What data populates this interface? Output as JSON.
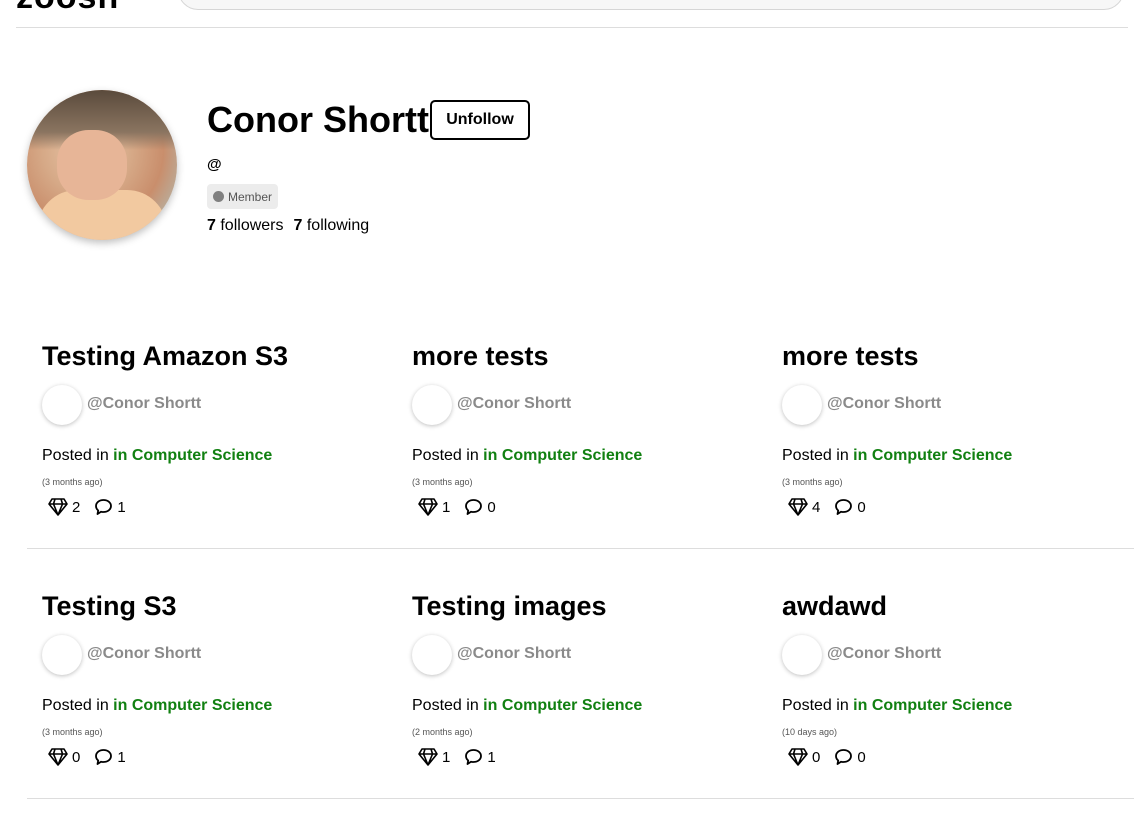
{
  "header": {
    "logo_text": "zoosh",
    "search_placeholder": ""
  },
  "profile": {
    "name": "Conor Shortt",
    "follow_button_label": "Unfollow",
    "handle": "@",
    "role_badge": "Member",
    "followers_count": "7",
    "followers_label": "followers",
    "following_count": "7",
    "following_label": "following"
  },
  "posts": [
    {
      "title": "Testing Amazon S3",
      "author": "@Conor Shortt",
      "posted_prefix": "Posted in",
      "category": "in Computer Science",
      "time": "(3 months ago)",
      "gems": "2",
      "comments": "1"
    },
    {
      "title": "more tests",
      "author": "@Conor Shortt",
      "posted_prefix": "Posted in",
      "category": "in Computer Science",
      "time": "(3 months ago)",
      "gems": "1",
      "comments": "0"
    },
    {
      "title": "more tests",
      "author": "@Conor Shortt",
      "posted_prefix": "Posted in",
      "category": "in Computer Science",
      "time": "(3 months ago)",
      "gems": "4",
      "comments": "0"
    },
    {
      "title": "Testing S3",
      "author": "@Conor Shortt",
      "posted_prefix": "Posted in",
      "category": "in Computer Science",
      "time": "(3 months ago)",
      "gems": "0",
      "comments": "1"
    },
    {
      "title": "Testing images",
      "author": "@Conor Shortt",
      "posted_prefix": "Posted in",
      "category": "in Computer Science",
      "time": "(2 months ago)",
      "gems": "1",
      "comments": "1"
    },
    {
      "title": "awdawd",
      "author": "@Conor Shortt",
      "posted_prefix": "Posted in",
      "category": "in Computer Science",
      "time": "(10 days ago)",
      "gems": "0",
      "comments": "0"
    }
  ],
  "colors": {
    "category_link": "#118011",
    "author_text": "#8a8a8a",
    "divider": "#dddddd"
  },
  "icons": {
    "gem": "gem-icon",
    "comment": "comment-bubble-icon"
  }
}
